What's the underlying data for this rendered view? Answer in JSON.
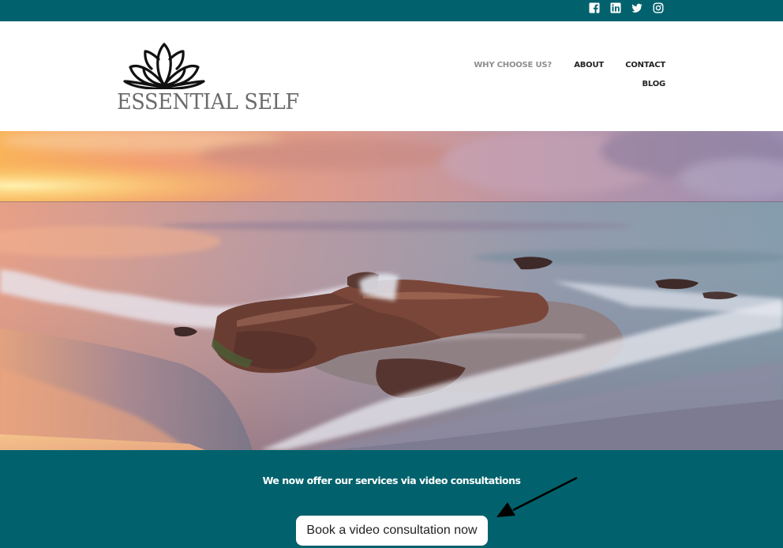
{
  "topbar": {
    "background": "#01626d",
    "social": [
      {
        "name": "facebook",
        "icon": "facebook-icon"
      },
      {
        "name": "linkedin",
        "icon": "linkedin-icon"
      },
      {
        "name": "twitter",
        "icon": "twitter-icon"
      },
      {
        "name": "instagram",
        "icon": "instagram-icon"
      }
    ]
  },
  "header": {
    "logo_text": "ESSENTIAL SELF",
    "logo_icon": "lotus-icon",
    "nav": [
      {
        "label": "WHY CHOOSE US?",
        "active": true
      },
      {
        "label": "ABOUT",
        "active": false
      },
      {
        "label": "CONTACT",
        "active": false
      },
      {
        "label": "BLOG",
        "active": false
      }
    ]
  },
  "hero": {
    "image": "sunset seascape with rocks and waves"
  },
  "cta": {
    "text": "We now offer our services via video consultations",
    "button_label": "Book a video consultation now",
    "annotation": "arrow pointing at button",
    "background": "#01626d"
  }
}
